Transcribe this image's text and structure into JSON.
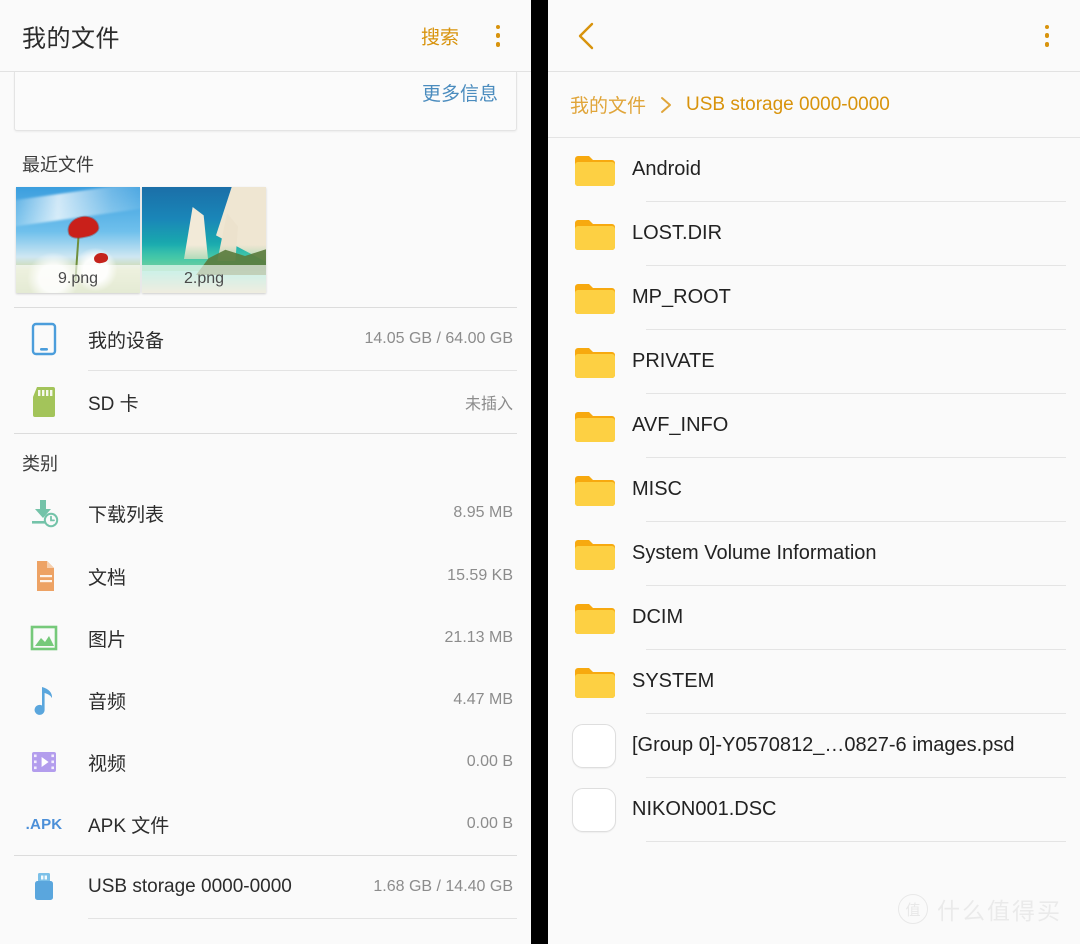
{
  "left": {
    "appbar": {
      "title": "我的文件",
      "search_label": "搜索",
      "menu_icon": "overflow-menu-icon"
    },
    "info_card": {
      "more_label": "更多信息"
    },
    "recent": {
      "heading": "最近文件",
      "items": [
        {
          "label": "9.png",
          "icon": "poppy-photo-thumbnail"
        },
        {
          "label": "2.png",
          "icon": "seascape-photo-thumbnail"
        }
      ]
    },
    "storage": [
      {
        "icon": "device-icon",
        "name": "我的设备",
        "meta": "14.05 GB / 64.00 GB"
      },
      {
        "icon": "sd-card-icon",
        "name": "SD 卡",
        "meta": "未插入"
      }
    ],
    "categories_heading": "类别",
    "categories": [
      {
        "icon": "download-icon",
        "name": "下载列表",
        "meta": "8.95 MB"
      },
      {
        "icon": "document-icon",
        "name": "文档",
        "meta": "15.59 KB"
      },
      {
        "icon": "image-icon",
        "name": "图片",
        "meta": "21.13 MB"
      },
      {
        "icon": "audio-icon",
        "name": "音频",
        "meta": "4.47 MB"
      },
      {
        "icon": "video-icon",
        "name": "视频",
        "meta": "0.00 B"
      },
      {
        "icon": "apk-icon",
        "name": "APK 文件",
        "meta": "0.00 B",
        "icon_text": ".APK"
      }
    ],
    "devices": [
      {
        "icon": "usb-drive-icon",
        "name": "USB storage 0000-0000",
        "meta": "1.68 GB / 14.40 GB"
      }
    ]
  },
  "right": {
    "appbar": {
      "back_icon": "back-chevron-icon",
      "menu_icon": "overflow-menu-icon"
    },
    "breadcrumb": [
      {
        "label": "我的文件",
        "current": false
      },
      {
        "label": "USB storage 0000-0000",
        "current": true
      }
    ],
    "files": [
      {
        "name": "Android",
        "type": "folder"
      },
      {
        "name": "LOST.DIR",
        "type": "folder"
      },
      {
        "name": "MP_ROOT",
        "type": "folder"
      },
      {
        "name": "PRIVATE",
        "type": "folder"
      },
      {
        "name": "AVF_INFO",
        "type": "folder"
      },
      {
        "name": "MISC",
        "type": "folder"
      },
      {
        "name": "System Volume Information",
        "type": "folder"
      },
      {
        "name": "DCIM",
        "type": "folder"
      },
      {
        "name": "SYSTEM",
        "type": "folder"
      },
      {
        "name": "[Group 0]-Y0570812_…0827-6 images.psd",
        "type": "file"
      },
      {
        "name": "NIKON001.DSC",
        "type": "file"
      }
    ]
  },
  "watermark": {
    "badge": "值",
    "text": "什么值得买"
  },
  "colors": {
    "accent_orange": "#d8930c",
    "link_blue": "#4b8cbe",
    "folder_yellow": "#fdd043",
    "folder_tab": "#f7a90f",
    "meta_gray": "#8c8c8c",
    "panel_bg": "#fafafa"
  }
}
